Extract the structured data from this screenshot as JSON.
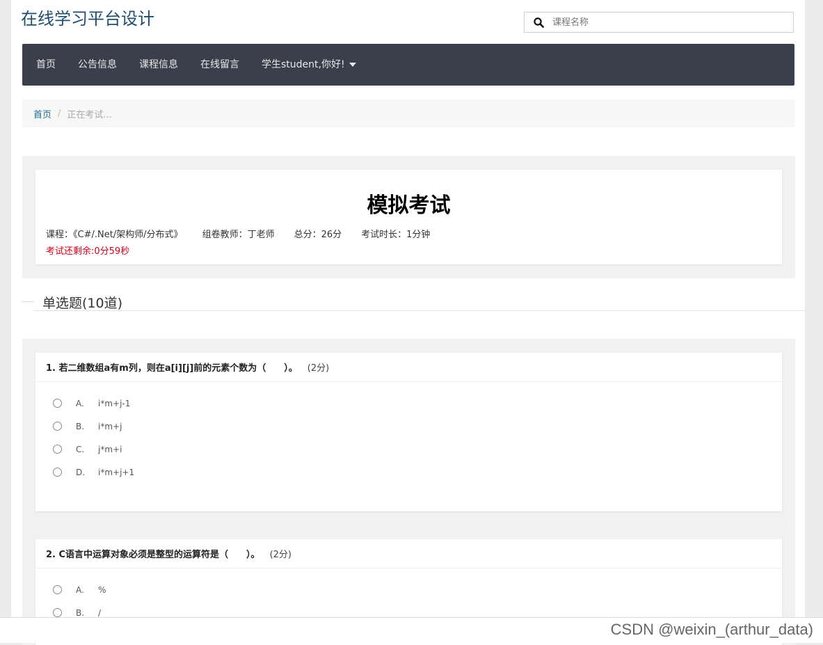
{
  "header": {
    "site_title": "在线学习平台设计",
    "search_placeholder": "课程名称",
    "search_icon": "search-icon"
  },
  "navbar": {
    "items": [
      {
        "label": "首页"
      },
      {
        "label": "公告信息"
      },
      {
        "label": "课程信息"
      },
      {
        "label": "在线留言"
      },
      {
        "label": "学生student,你好!"
      }
    ],
    "bg_color": "#3b3f4b"
  },
  "breadcrumb": {
    "home": "首页",
    "separator": "/",
    "current": "正在考试..."
  },
  "exam": {
    "title": "模拟考试",
    "course": "课程：《C#/.Net/架构师/分布式》",
    "teacher": "组卷教师：丁老师",
    "total_score": "总分：26分",
    "duration": "考试时长：1分钟",
    "remaining": "考试还剩余:0分59秒",
    "remaining_color": "#d0021b"
  },
  "section": {
    "label": "单选题(10道)"
  },
  "questions": [
    {
      "text": "1. 若二维数组a有m列，则在a[i][j]前的元素个数为（　　）。",
      "score": "(2分)",
      "options": [
        {
          "letter": "A.",
          "text": "i*m+j-1"
        },
        {
          "letter": "B.",
          "text": "i*m+j"
        },
        {
          "letter": "C.",
          "text": "j*m+i"
        },
        {
          "letter": "D.",
          "text": "i*m+j+1"
        }
      ]
    },
    {
      "text": "2. C语言中运算对象必须是整型的运算符是（　　）。",
      "score": "(2分)",
      "options": [
        {
          "letter": "A.",
          "text": "%"
        },
        {
          "letter": "B.",
          "text": "/"
        }
      ]
    }
  ],
  "watermark": "CSDN @weixin_(arthur_data)"
}
